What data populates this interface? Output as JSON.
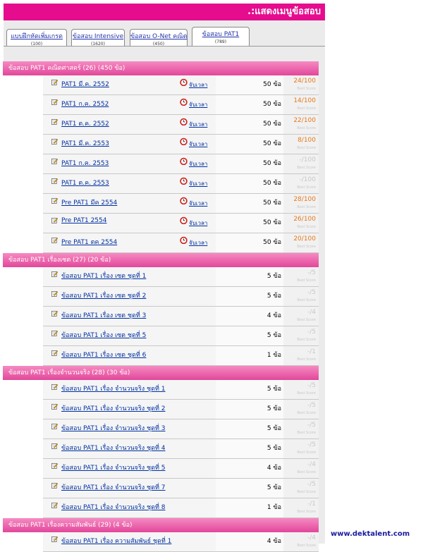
{
  "title": ".:แสดงเมนูข้อสอบ",
  "tabs": [
    {
      "label": "แบบฝึกหัดเพิ่มเกรด",
      "count": "(100)"
    },
    {
      "label": "ข้อสอบ Intensive",
      "count": "(1620)"
    },
    {
      "label": "ข้อสอบ O-Net คณิต",
      "count": "(450)"
    },
    {
      "label": "ข้อสอบ PAT1",
      "count": "(789)",
      "active": true
    }
  ],
  "best_score_label": "Best Score",
  "timer_label": "จับเวลา",
  "sections": [
    {
      "header": "ข้อสอบ PAT1 คณิตศาสตร์ (26) (450 ข้อ)",
      "rows": [
        {
          "name": "PAT1 มี.ค. 2552",
          "count": "50 ข้อ",
          "score": "24/100",
          "timer": true
        },
        {
          "name": "PAT1 ก.ค. 2552",
          "count": "50 ข้อ",
          "score": "14/100",
          "timer": true
        },
        {
          "name": "PAT1 ต.ค. 2552",
          "count": "50 ข้อ",
          "score": "22/100",
          "timer": true
        },
        {
          "name": "PAT1 มี.ค. 2553",
          "count": "50 ข้อ",
          "score": "8/100",
          "timer": true
        },
        {
          "name": "PAT1 ก.ค. 2553",
          "count": "50 ข้อ",
          "score": "-/100",
          "timer": true
        },
        {
          "name": "PAT1 ต.ค. 2553",
          "count": "50 ข้อ",
          "score": "-/100",
          "timer": true
        },
        {
          "name": "Pre PAT1 มีค 2554",
          "count": "50 ข้อ",
          "score": "28/100",
          "timer": true
        },
        {
          "name": "Pre PAT1 2554",
          "count": "50 ข้อ",
          "score": "26/100",
          "timer": true
        },
        {
          "name": "Pre PAT1 ตค 2554",
          "count": "50 ข้อ",
          "score": "20/100",
          "timer": true
        }
      ]
    },
    {
      "header": "ข้อสอบ PAT1 เรื่องเซต (27) (20 ข้อ)",
      "rows": [
        {
          "name": "ข้อสอบ PAT1 เรื่อง เซต ชุดที่ 1",
          "count": "5 ข้อ",
          "score": "-/5"
        },
        {
          "name": "ข้อสอบ PAT1 เรื่อง เซต ชุดที่ 2",
          "count": "5 ข้อ",
          "score": "-/5"
        },
        {
          "name": "ข้อสอบ PAT1 เรื่อง เซต ชุดที่ 3",
          "count": "4 ข้อ",
          "score": "-/4"
        },
        {
          "name": "ข้อสอบ PAT1 เรื่อง เซต ชุดที่ 5",
          "count": "5 ข้อ",
          "score": "-/5"
        },
        {
          "name": "ข้อสอบ PAT1 เรื่อง เซต ชุดที่ 6",
          "count": "1 ข้อ",
          "score": "-/1"
        }
      ]
    },
    {
      "header": "ข้อสอบ PAT1 เรื่องจำนวนจริง (28) (30 ข้อ)",
      "rows": [
        {
          "name": "ข้อสอบ PAT1 เรื่อง จำนวนจริง ชุดที่ 1",
          "count": "5 ข้อ",
          "score": "-/5"
        },
        {
          "name": "ข้อสอบ PAT1 เรื่อง จำนวนจริง ชุดที่ 2",
          "count": "5 ข้อ",
          "score": "-/5"
        },
        {
          "name": "ข้อสอบ PAT1 เรื่อง จำนวนจริง ชุดที่ 3",
          "count": "5 ข้อ",
          "score": "-/5"
        },
        {
          "name": "ข้อสอบ PAT1 เรื่อง จำนวนจริง ชุดที่ 4",
          "count": "5 ข้อ",
          "score": "-/5"
        },
        {
          "name": "ข้อสอบ PAT1 เรื่อง จำนวนจริง ชุดที่ 5",
          "count": "4 ข้อ",
          "score": "-/4"
        },
        {
          "name": "ข้อสอบ PAT1 เรื่อง จำนวนจริง ชุดที่ 7",
          "count": "5 ข้อ",
          "score": "-/5"
        },
        {
          "name": "ข้อสอบ PAT1 เรื่อง จำนวนจริง ชุดที่ 8",
          "count": "1 ข้อ",
          "score": "-/1"
        }
      ]
    },
    {
      "header": "ข้อสอบ PAT1 เรื่องความสัมพันธ์ (29) (4 ข้อ)",
      "rows": [
        {
          "name": "ข้อสอบ PAT1 เรื่อง ความสัมพันธ์ ชุดที่ 1",
          "count": "4 ข้อ",
          "score": "-/4"
        }
      ]
    }
  ],
  "site": "www.dektalent.com",
  "colors": {
    "brand": "#e60c8e",
    "score": "#e8781a",
    "link": "#0030a0"
  }
}
